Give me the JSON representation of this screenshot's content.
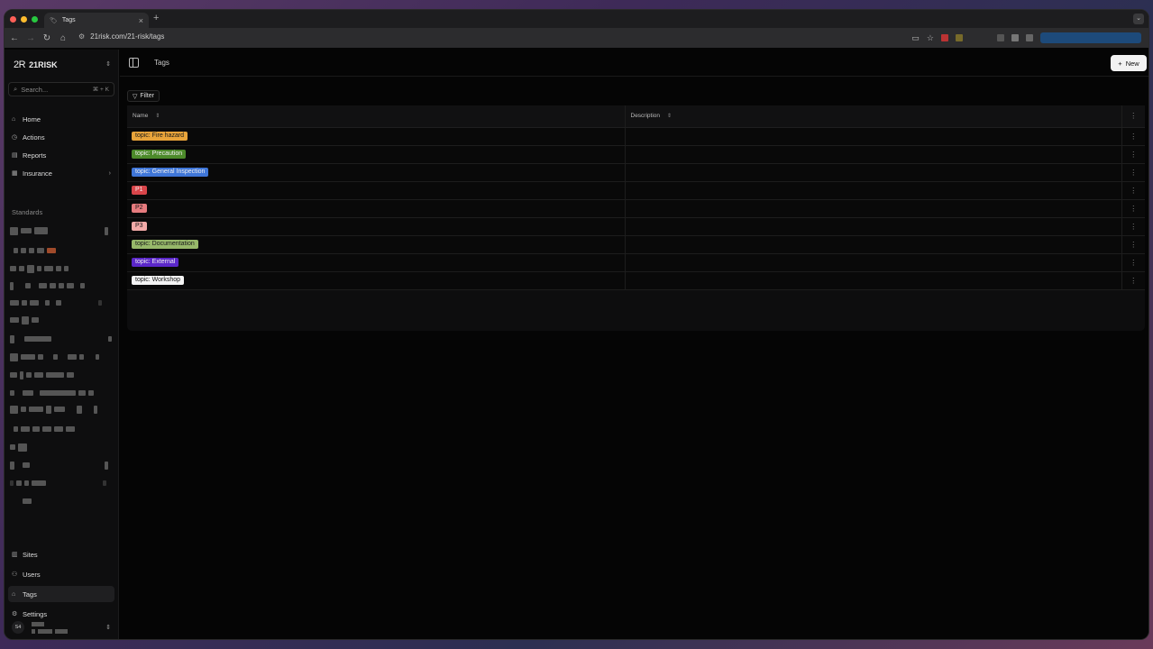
{
  "browser": {
    "tab_title": "Tags",
    "url": "21risk.com/21-risk/tags"
  },
  "sidebar": {
    "brand": "21RISK",
    "logo_text": "2R",
    "search_placeholder": "Search...",
    "search_shortcut": "⌘ + K",
    "nav": [
      {
        "label": "Home",
        "icon": "home-icon"
      },
      {
        "label": "Actions",
        "icon": "actions-icon"
      },
      {
        "label": "Reports",
        "icon": "reports-icon"
      },
      {
        "label": "Insurance",
        "icon": "insurance-icon"
      }
    ],
    "standards_title": "Standards",
    "bottom_nav": [
      {
        "label": "Sites",
        "icon": "sites-icon"
      },
      {
        "label": "Users",
        "icon": "users-icon"
      },
      {
        "label": "Tags",
        "icon": "tag-icon"
      },
      {
        "label": "Settings",
        "icon": "settings-icon"
      }
    ],
    "user_initials": "S4"
  },
  "main": {
    "page_title": "Tags",
    "new_button": "New",
    "filter_button": "Filter",
    "columns": {
      "name": "Name",
      "description": "Description"
    },
    "rows": [
      {
        "tag": "topic: Fire hazard",
        "color": "#e8a33a",
        "text_color": "#1a1a1a",
        "description": ""
      },
      {
        "tag": "topic: Precaution",
        "color": "#4c8a2a",
        "text_color": "#f0f0f0",
        "description": ""
      },
      {
        "tag": "topic: General Inspection",
        "color": "#3f76d8",
        "text_color": "#f0f0f0",
        "description": ""
      },
      {
        "tag": "P1",
        "color": "#d9454a",
        "text_color": "#f0f0f0",
        "description": ""
      },
      {
        "tag": "P2",
        "color": "#e67b7e",
        "text_color": "#1a1a1a",
        "description": ""
      },
      {
        "tag": "P3",
        "color": "#f2aaa8",
        "text_color": "#1a1a1a",
        "description": ""
      },
      {
        "tag": "topic: Documentation",
        "color": "#97b86a",
        "text_color": "#1a1a1a",
        "description": ""
      },
      {
        "tag": "topic: External",
        "color": "#5b27c9",
        "text_color": "#f0f0f0",
        "description": ""
      },
      {
        "tag": "topic: Workshop",
        "color": "#f4f4f4",
        "text_color": "#111111",
        "description": ""
      }
    ]
  }
}
